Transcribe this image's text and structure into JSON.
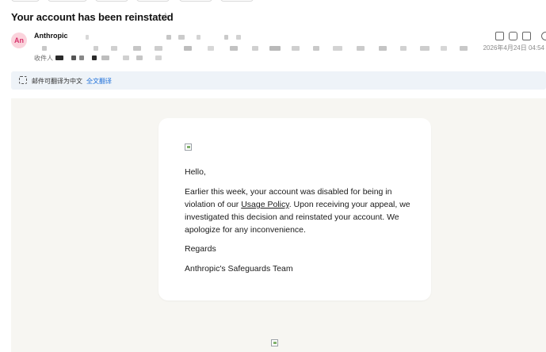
{
  "email": {
    "subject": "Your account has been reinstated",
    "star_icon": "star-icon",
    "sender": {
      "avatar_text": "An",
      "name": "Anthropic"
    },
    "recipient_label": "收件人",
    "date": "2026年4月24日 04:54"
  },
  "translate_bar": {
    "text": "邮件可翻译为中文",
    "link": "全文翻译"
  },
  "message": {
    "greeting": "Hello,",
    "para_before": "Earlier this week, your account was disabled for being in violation of our ",
    "para_link": "Usage Policy",
    "para_after": ". Upon receiving your appeal, we investigated this decision and reinstated your account. We apologize for any inconvenience.",
    "regards": "Regards",
    "signature": "Anthropic's Safeguards Team"
  },
  "colors": {
    "avatar_bg": "#fbd3dc",
    "avatar_text": "#d6336c",
    "link": "#1e6fd9",
    "mail_background": "#f7f6f2",
    "translate_bar_bg": "#eef3f8"
  }
}
